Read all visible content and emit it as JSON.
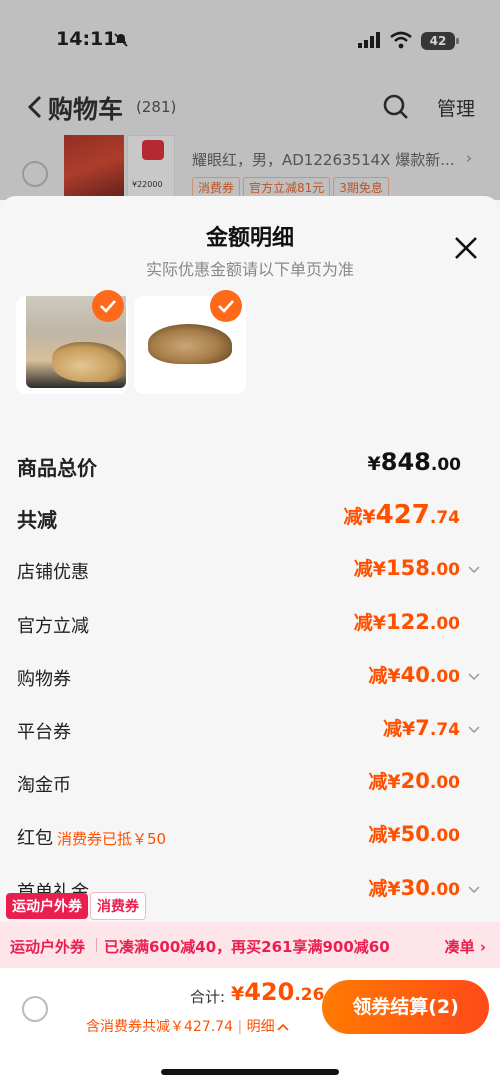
{
  "status_bar": {
    "time": "14:11",
    "battery": "42"
  },
  "cart_header": {
    "title": "购物车",
    "count": "(281)",
    "manage": "管理"
  },
  "bg_item": {
    "desc": "耀眼红，男，AD12263514X 爆款新...",
    "thumb_price": "¥22000",
    "tags": [
      "消费券",
      "官方立减81元",
      "3期免息"
    ]
  },
  "sheet": {
    "title": "金额明细",
    "subtitle": "实际优惠金额请以下单页为准"
  },
  "rows": {
    "total_price": {
      "label": "商品总价",
      "prefix": "¥",
      "int": "848",
      "dec": ".00"
    },
    "total_reduce": {
      "label": "共减",
      "prefix": "减¥",
      "int": "427",
      "dec": ".74"
    },
    "store_discount": {
      "label": "店铺优惠",
      "prefix": "减¥",
      "int": "158",
      "dec": ".00"
    },
    "official_reduce": {
      "label": "官方立减",
      "prefix": "减¥",
      "int": "122",
      "dec": ".00"
    },
    "shopping_coupon": {
      "label": "购物券",
      "prefix": "减¥",
      "int": "40",
      "dec": ".00"
    },
    "platform_coupon": {
      "label": "平台券",
      "prefix": "减¥",
      "int": "7",
      "dec": ".74"
    },
    "taojinbi": {
      "label": "淘金币",
      "prefix": "减¥",
      "int": "20",
      "dec": ".00"
    },
    "red_packet": {
      "label": "红包",
      "note": "消费券已抵￥50",
      "prefix": "减¥",
      "int": "50",
      "dec": ".00"
    },
    "first_order_gift": {
      "label": "首单礼金",
      "prefix": "减¥",
      "int": "30",
      "dec": ".00"
    }
  },
  "coupon_tabs": [
    "运动户外券",
    "消费券"
  ],
  "coupon_strip": {
    "label": "运动户外券",
    "text": "已凑满600减40，再买261享满900减60",
    "action": "凑单 ›"
  },
  "bottom_bar": {
    "total_label": "合计:",
    "total_prefix": "¥",
    "total_int": "420",
    "total_dec": ".26",
    "discount_text": "含消费券共减￥427.74",
    "detail": "明细",
    "checkout": "领券结算(2)"
  },
  "colors": {
    "accent": "#ff5000",
    "checkout_gradient": [
      "#ff7a00",
      "#ff4a1a"
    ],
    "coupon_pink": "#e9204f"
  }
}
